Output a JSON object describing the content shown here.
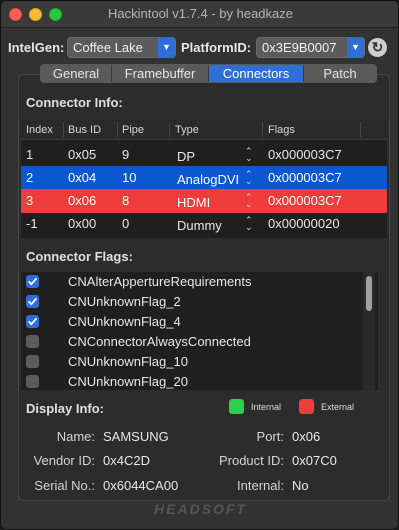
{
  "window": {
    "title": "Hackintool v1.7.4 - by headkaze"
  },
  "top": {
    "intelgen_label": "IntelGen:",
    "intelgen_value": "Coffee Lake",
    "platform_label": "PlatformID:",
    "platform_value": "0x3E9B0007"
  },
  "tabs": [
    {
      "label": "General"
    },
    {
      "label": "Framebuffer"
    },
    {
      "label": "Connectors"
    },
    {
      "label": "Patch"
    }
  ],
  "connector_info": {
    "title": "Connector Info:",
    "columns": [
      "Index",
      "Bus ID",
      "Pipe",
      "Type",
      "Flags"
    ],
    "rows": [
      {
        "index": "1",
        "bus_id": "0x05",
        "pipe": "9",
        "type": "DP",
        "flags": "0x000003C7",
        "highlight": "none"
      },
      {
        "index": "2",
        "bus_id": "0x04",
        "pipe": "10",
        "type": "AnalogDVI",
        "flags": "0x000003C7",
        "highlight": "internal"
      },
      {
        "index": "3",
        "bus_id": "0x06",
        "pipe": "8",
        "type": "HDMI",
        "flags": "0x000003C7",
        "highlight": "external"
      },
      {
        "index": "-1",
        "bus_id": "0x00",
        "pipe": "0",
        "type": "Dummy",
        "flags": "0x00000020",
        "highlight": "none"
      }
    ]
  },
  "connector_flags": {
    "title": "Connector Flags:",
    "items": [
      {
        "label": "CNAlterAppertureRequirements",
        "checked": true
      },
      {
        "label": "CNUnknownFlag_2",
        "checked": true
      },
      {
        "label": "CNUnknownFlag_4",
        "checked": true
      },
      {
        "label": "CNConnectorAlwaysConnected",
        "checked": false
      },
      {
        "label": "CNUnknownFlag_10",
        "checked": false
      },
      {
        "label": "CNUnknownFlag_20",
        "checked": false
      }
    ]
  },
  "display_info": {
    "title": "Display Info:",
    "legend_internal": "Internal",
    "legend_external": "External",
    "name_label": "Name:",
    "name_value": "SAMSUNG",
    "port_label": "Port:",
    "port_value": "0x06",
    "vendor_label": "Vendor ID:",
    "vendor_value": "0x4C2D",
    "product_label": "Product ID:",
    "product_value": "0x07C0",
    "serial_label": "Serial No.:",
    "serial_value": "0x6044CA00",
    "internal_label": "Internal:",
    "internal_value": "No"
  },
  "footer": {
    "brand": "HEADSOFT"
  },
  "colors": {
    "accent": "#2f6ed6",
    "internal_row": "#0a57cf",
    "external_row": "#f03b3b",
    "internal_legend": "#2bd14a",
    "external_legend": "#f03b3b"
  },
  "icons": {
    "refresh": "refresh-icon",
    "popup_arrow": "chevron-down-icon",
    "stepper": "up-down-stepper-icon",
    "check": "checkmark-icon"
  }
}
